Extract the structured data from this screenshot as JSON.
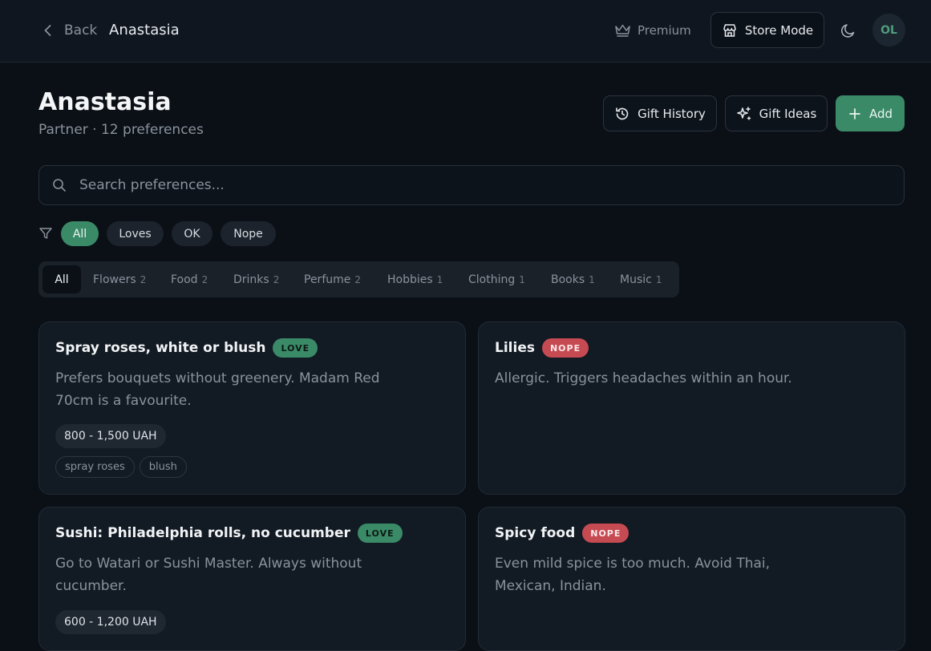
{
  "header": {
    "back_label": "Back",
    "profile_name": "Anastasia",
    "premium_label": "Premium",
    "store_mode_label": "Store Mode",
    "avatar_initials": "OL"
  },
  "profile": {
    "name": "Anastasia",
    "subtitle": "Partner · 12 preferences"
  },
  "actions": {
    "gift_history": "Gift History",
    "gift_ideas": "Gift Ideas",
    "add": "Add"
  },
  "search": {
    "placeholder": "Search preferences..."
  },
  "sentiment_filters": [
    {
      "label": "All",
      "active": true
    },
    {
      "label": "Loves",
      "active": false
    },
    {
      "label": "OK",
      "active": false
    },
    {
      "label": "Nope",
      "active": false
    }
  ],
  "categories": [
    {
      "label": "All",
      "count": "",
      "active": true
    },
    {
      "label": "Flowers",
      "count": "2"
    },
    {
      "label": "Food",
      "count": "2"
    },
    {
      "label": "Drinks",
      "count": "2"
    },
    {
      "label": "Perfume",
      "count": "2"
    },
    {
      "label": "Hobbies",
      "count": "1"
    },
    {
      "label": "Clothing",
      "count": "1"
    },
    {
      "label": "Books",
      "count": "1"
    },
    {
      "label": "Music",
      "count": "1"
    }
  ],
  "cards": [
    {
      "title": "Spray roses, white or blush",
      "badge": "LOVE",
      "description": "Prefers bouquets without greenery. Madam Red 70cm is a favourite.",
      "price": "800 - 1,500 UAH",
      "tags": [
        "spray roses",
        "blush"
      ]
    },
    {
      "title": "Lilies",
      "badge": "NOPE",
      "description": "Allergic. Triggers headaches within an hour."
    },
    {
      "title": "Sushi: Philadelphia rolls, no cucumber",
      "badge": "LOVE",
      "description": "Go to Watari or Sushi Master. Always without cucumber.",
      "price": "600 - 1,200 UAH"
    },
    {
      "title": "Spicy food",
      "badge": "NOPE",
      "description": "Even mild spice is too much. Avoid Thai, Mexican, Indian."
    }
  ],
  "colors": {
    "accent": "#3a8a68",
    "love": "#3a8a68",
    "nope": "#c64a52",
    "background": "#0b1017"
  }
}
